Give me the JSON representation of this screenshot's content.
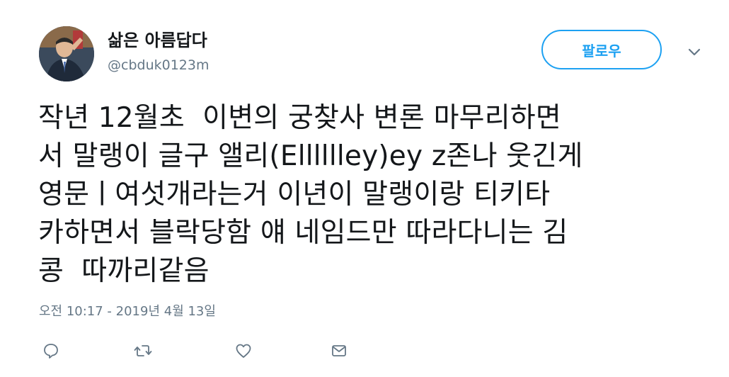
{
  "user": {
    "display_name": "삶은 아름답다",
    "handle": "@cbduk0123m"
  },
  "follow_label": "팔로우",
  "tweet": {
    "text": "작년 12월초  이변의 궁찾사 변론 마무리하면\n서 말랭이 글구 앨리(Elllllley)ey z존나 웃긴게\n영문ㅣ여섯개라는거 이년이 말랭이랑 티키타\n카하면서 블락당함 얘 네임드만 따라다니는 김\n콩  따까리같음",
    "timestamp": "오전 10:17 - 2019년 4월 13일"
  },
  "icons": {
    "reply": "reply-icon",
    "retweet": "retweet-icon",
    "like": "heart-icon",
    "dm": "envelope-icon",
    "caret": "chevron-down-icon"
  },
  "colors": {
    "accent": "#1da1f2",
    "secondary_text": "#657786",
    "primary_text": "#14171a"
  }
}
